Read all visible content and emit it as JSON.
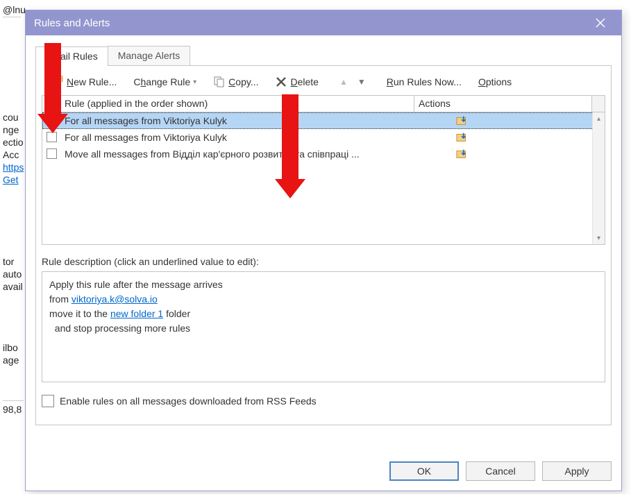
{
  "background": {
    "top": "@lnu",
    "lines": [
      "cou",
      "nge",
      "ectio",
      " Acc",
      "https",
      "Get"
    ],
    "lines2": [
      "tor",
      "auto",
      "avail"
    ],
    "lines3": [
      "ilbo",
      "age"
    ],
    "bottom": "98,8"
  },
  "dialog": {
    "title": "Rules and Alerts"
  },
  "tabs": {
    "tab1": "Email Rules",
    "tab2": "Manage Alerts"
  },
  "toolbar": {
    "new": "New Rule...",
    "change": "Change Rule",
    "copy": "Copy...",
    "delete": "Delete",
    "run": "Run Rules Now...",
    "options": "Options"
  },
  "headers": {
    "rule": "Rule (applied in the order shown)",
    "actions": "Actions"
  },
  "rules": [
    {
      "checked": true,
      "name": "For all messages from Viktoriya Kulyk",
      "selected": true
    },
    {
      "checked": false,
      "name": "For all messages from Viktoriya Kulyk",
      "selected": false
    },
    {
      "checked": false,
      "name": "Move all messages from Відділ кар'єрного розвитку та співпраці ...",
      "selected": false
    }
  ],
  "description": {
    "label": "Rule description (click an underlined value to edit):",
    "line1": "Apply this rule after the message arrives",
    "line2_pre": "from ",
    "line2_link": "viktoriya.k@solva.io",
    "line3_pre": "move it to the ",
    "line3_link": "new folder 1",
    "line3_post": " folder",
    "line4": "  and stop processing more rules"
  },
  "rss": "Enable rules on all messages downloaded from RSS Feeds",
  "buttons": {
    "ok": "OK",
    "cancel": "Cancel",
    "apply": "Apply"
  }
}
